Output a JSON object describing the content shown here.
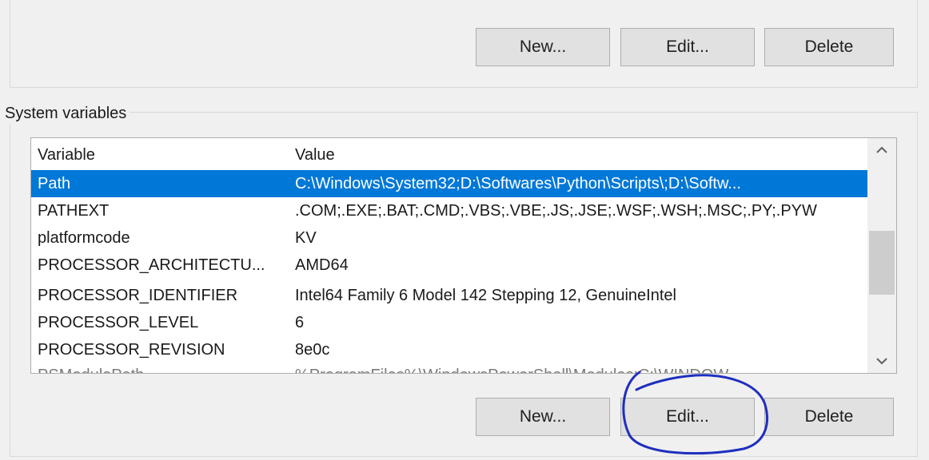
{
  "user_buttons": {
    "new": "New...",
    "edit": "Edit...",
    "delete": "Delete"
  },
  "system_variables": {
    "group_label": "System variables",
    "columns": {
      "variable": "Variable",
      "value": "Value"
    },
    "rows": [
      {
        "variable": "Path",
        "value": "C:\\Windows\\System32;D:\\Softwares\\Python\\Scripts\\;D:\\Softw..."
      },
      {
        "variable": "PATHEXT",
        "value": ".COM;.EXE;.BAT;.CMD;.VBS;.VBE;.JS;.JSE;.WSF;.WSH;.MSC;.PY;.PYW"
      },
      {
        "variable": "platformcode",
        "value": "KV"
      },
      {
        "variable": "PROCESSOR_ARCHITECTU...",
        "value": "AMD64"
      },
      {
        "variable": "PROCESSOR_IDENTIFIER",
        "value": "Intel64 Family 6 Model 142 Stepping 12, GenuineIntel"
      },
      {
        "variable": "PROCESSOR_LEVEL",
        "value": "6"
      },
      {
        "variable": "PROCESSOR_REVISION",
        "value": "8e0c"
      },
      {
        "variable": "PSModulePath",
        "value": "%ProgramFiles%\\WindowsPowerShell\\Modules;C:\\WINDOW..."
      }
    ],
    "selected_row": 0,
    "buttons": {
      "new": "New...",
      "edit": "Edit...",
      "delete": "Delete"
    },
    "scroll_up_icon": "chevron-up-icon",
    "scroll_down_icon": "chevron-down-icon"
  },
  "colors": {
    "selection": "#0078d7",
    "annotation": "#1f2fbf"
  }
}
